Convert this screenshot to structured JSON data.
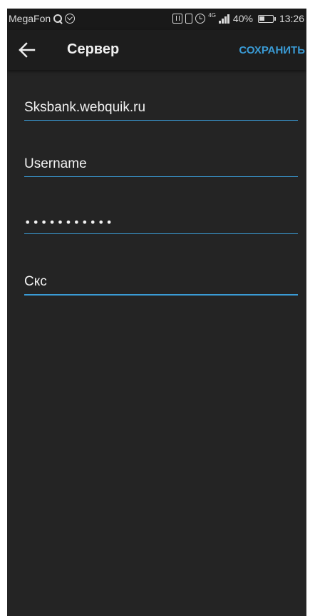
{
  "status_bar": {
    "carrier": "MegaFon",
    "network": "4G",
    "battery": "40%",
    "time": "13:26"
  },
  "app_bar": {
    "title": "Сервер",
    "save_label": "СОХРАНИТЬ"
  },
  "form": {
    "server": "Sksbank.webquik.ru",
    "username": "Username",
    "password_mask": "•••••••••••",
    "name": "Скс"
  },
  "colors": {
    "accent": "#3a9bd5",
    "background": "#242424",
    "app_bar": "#1d1d1d"
  },
  "icons": {
    "back": "arrow-back-icon"
  }
}
